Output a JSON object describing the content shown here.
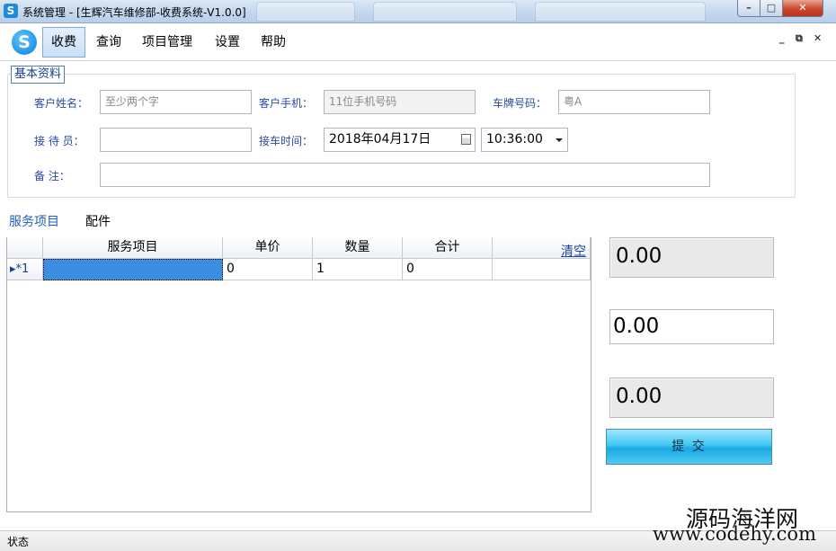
{
  "window": {
    "title": "系统管理 - [生辉汽车维修部-收费系统-V1.0.0]",
    "controls": {
      "minimize": "–",
      "restore": "□",
      "close": "✕"
    }
  },
  "menu": {
    "items": [
      {
        "id": "charge",
        "label": "收费"
      },
      {
        "id": "query",
        "label": "查询"
      },
      {
        "id": "project",
        "label": "项目管理"
      },
      {
        "id": "settings",
        "label": "设置"
      },
      {
        "id": "help",
        "label": "帮助"
      }
    ],
    "mdi_controls": {
      "minimize": "_",
      "restore": "⧉",
      "close": "✕"
    }
  },
  "basic_info": {
    "legend": "基本资料",
    "customer_name": {
      "label": "客户姓名：",
      "placeholder": "至少两个字",
      "value": ""
    },
    "customer_phone": {
      "label": "客户手机：",
      "placeholder": "11位手机号码",
      "value": ""
    },
    "plate_number": {
      "label": "车牌号码：",
      "value": "粤A"
    },
    "receptionist": {
      "label": "接 待 员：",
      "value": ""
    },
    "pickup_time": {
      "label": "接车时间：",
      "date": "2018年04月17日",
      "time": "10:36:00"
    },
    "remarks": {
      "label": "备    注：",
      "value": ""
    }
  },
  "tabs": [
    {
      "label": "服务项目",
      "selected": true
    },
    {
      "label": "配件",
      "selected": false
    }
  ],
  "grid": {
    "columns": [
      "服务项目",
      "单价",
      "数量",
      "合计"
    ],
    "clear_link": "清空",
    "rows": [
      {
        "indicator": "▸*1",
        "service": "",
        "unit_price": "0",
        "quantity": "1",
        "subtotal": "0"
      }
    ]
  },
  "totals": [
    "0.00",
    "0.00",
    "0.00"
  ],
  "submit_label": "提 交",
  "status": "状态",
  "watermark": {
    "line1": "源码海洋网",
    "line2": "www.codehy.com"
  }
}
